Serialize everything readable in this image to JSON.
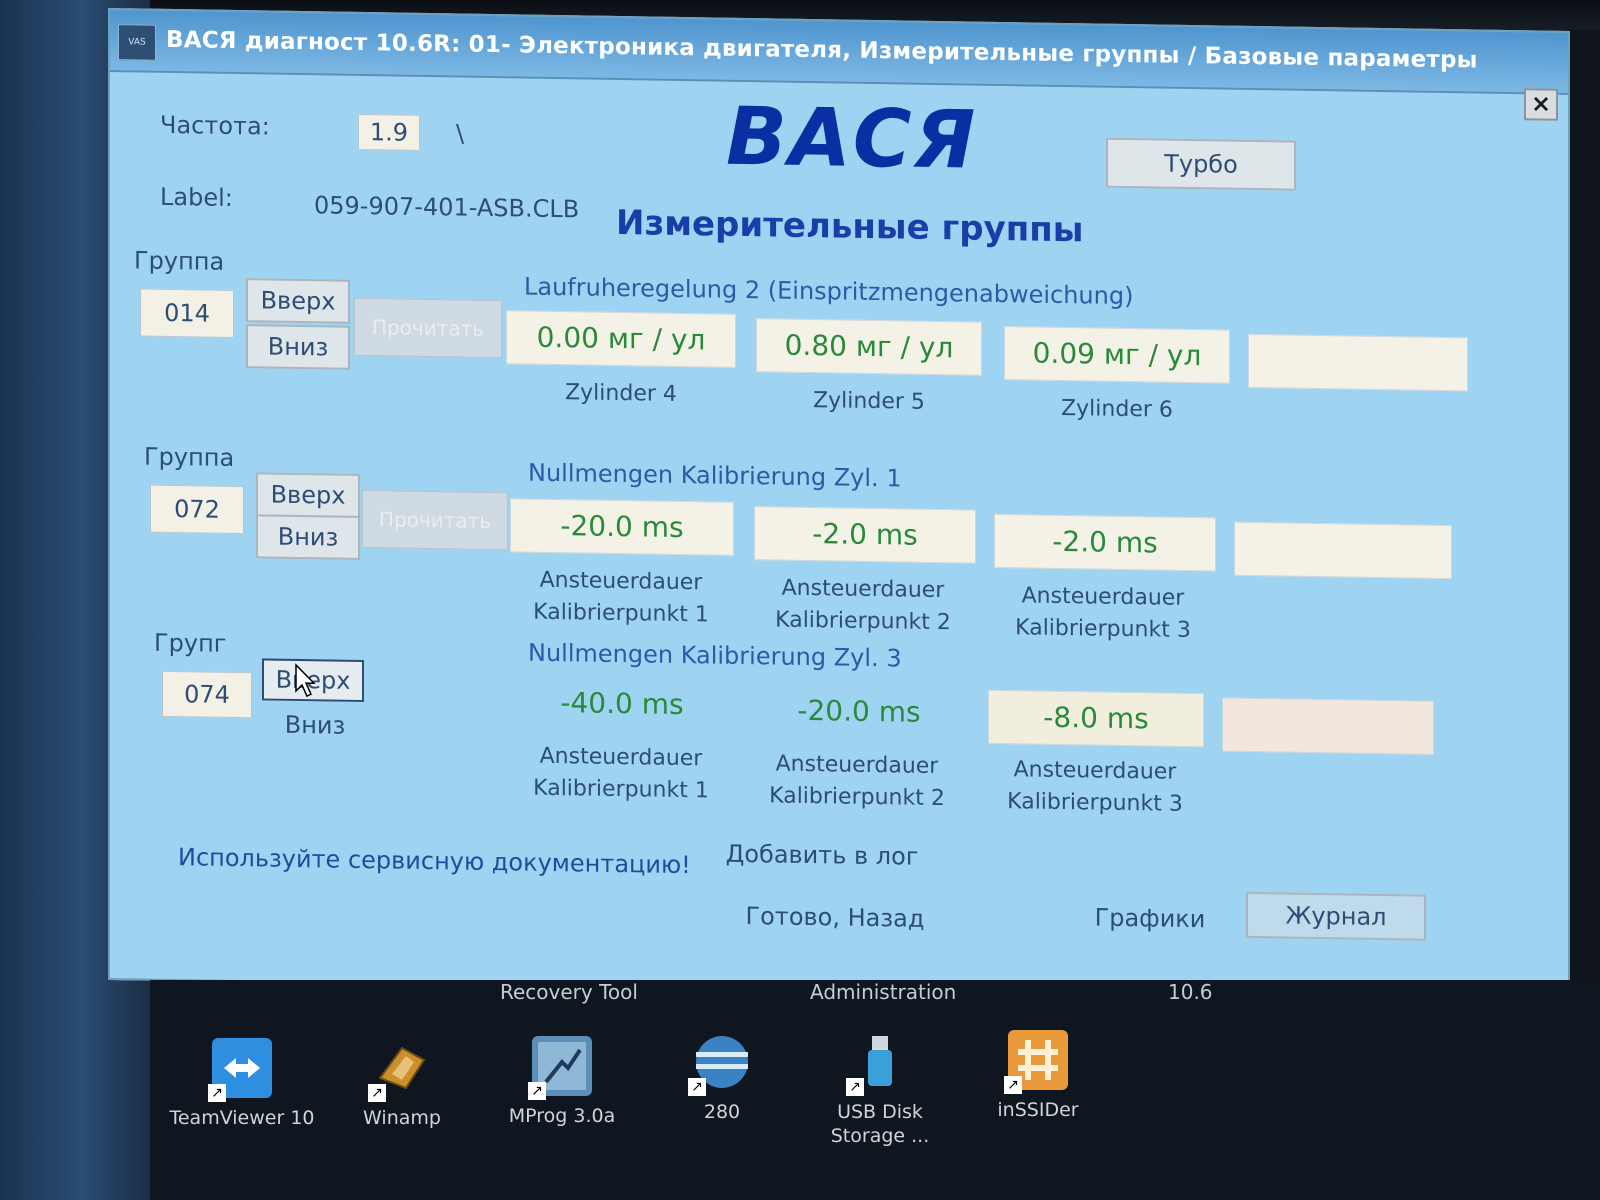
{
  "window": {
    "title": "ВАСЯ диагност 10.6R: 01- Электроника двигателя,  Измерительные группы / Базовые параметры",
    "close_label": "×",
    "brand": "ВАСЯ",
    "section_title": "Измерительные группы"
  },
  "header": {
    "freq_label": "Частота:",
    "freq_value": "1.9",
    "freq_mark": "\\",
    "label_label": "Label:",
    "label_value": "059-907-401-ASB.CLB",
    "turbo_button": "Турбо"
  },
  "groups": [
    {
      "caption": "Группа",
      "number": "014",
      "up_label": "Вверх",
      "down_label": "Вниз",
      "read_label": "Прочитать",
      "name": "Laufruheregelung 2 (Einspritzmengenabweichung)",
      "values": [
        "0.00 мг / ул",
        "0.80 мг / ул",
        "0.09 мг / ул",
        ""
      ],
      "descriptions": [
        "Zylinder 4",
        "Zylinder 5",
        "Zylinder 6"
      ]
    },
    {
      "caption": "Группа",
      "number": "072",
      "up_label": "Вверх",
      "down_label": "Вниз",
      "read_label": "Прочитать",
      "name": "Nullmengen Kalibrierung Zyl. 1",
      "values": [
        "-20.0 ms",
        "-2.0 ms",
        "-2.0 ms",
        ""
      ],
      "descriptions": [
        "Ansteuerdauer Kalibrierpunkt 1",
        "Ansteuerdauer Kalibrierpunkt 2",
        "Ansteuerdauer Kalibrierpunkt 3"
      ]
    },
    {
      "caption": "Групг",
      "number": "074",
      "up_label": "Вверх",
      "down_label": "Вниз",
      "name": "Nullmengen Kalibrierung Zyl. 3",
      "values": [
        "-40.0 ms",
        "-20.0 ms",
        "-8.0 ms",
        ""
      ],
      "descriptions": [
        "Ansteuerdauer Kalibrierpunkt 1",
        "Ansteuerdauer Kalibrierpunkt 2",
        "Ansteuerdauer Kalibrierpunkt 3"
      ]
    }
  ],
  "footer": {
    "note": "Используйте сервисную документацию!",
    "add_log": "Добавить в лог",
    "done_back": "Готово, Назад",
    "graphs": "Графики",
    "journal": "Журнал"
  },
  "taskbar": {
    "items": [
      "Recovery Tool",
      "Administration",
      "10.6"
    ]
  },
  "desktop_icons": [
    {
      "label": "TeamViewer 10",
      "icon": "teamviewer-icon",
      "color": "#2e8fe0"
    },
    {
      "label": "Winamp",
      "icon": "winamp-icon",
      "color": "#c9902c"
    },
    {
      "label": "MProg 3.0a",
      "icon": "mprog-icon",
      "color": "#5b8fb9"
    },
    {
      "label": "280",
      "icon": "globe-icon",
      "color": "#3a82c4"
    },
    {
      "label": "USB Disk Storage ...",
      "icon": "usb-icon",
      "color": "#3aa0d8"
    },
    {
      "label": "inSSIDer",
      "icon": "inssider-icon",
      "color": "#e89a3a"
    }
  ]
}
